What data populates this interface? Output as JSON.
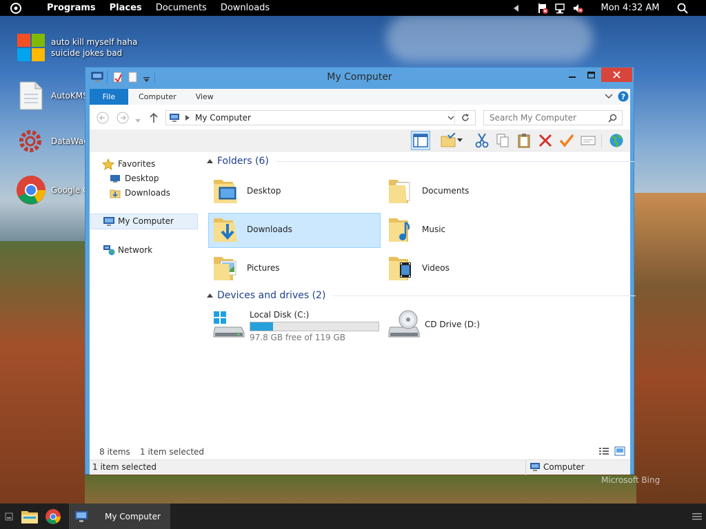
{
  "topbar": {
    "menus": [
      "Programs",
      "Places",
      "Documents",
      "Downloads"
    ],
    "clock": "Mon 4:32 AM"
  },
  "desktop": {
    "icons": [
      {
        "label_line1": "auto kill myself haha",
        "label_line2": "suicide jokes bad",
        "icon": "windows-logo-icon"
      },
      {
        "label": "AutoKMS",
        "icon": "document-icon"
      },
      {
        "label": "DataWag",
        "icon": "gear-icon"
      },
      {
        "label": "Google C",
        "icon": "chrome-icon"
      }
    ],
    "watermark": "Microsoft Bing"
  },
  "window": {
    "title": "My Computer",
    "ribbon_tabs": [
      "File",
      "Computer",
      "View"
    ],
    "address": "My Computer",
    "search_placeholder": "Search My Computer",
    "nav": {
      "favorites": "Favorites",
      "favorite_items": [
        "Desktop",
        "Downloads"
      ],
      "computer": "My Computer",
      "network": "Network"
    },
    "folders_header": "Folders (6)",
    "folders": [
      "Desktop",
      "Documents",
      "Downloads",
      "Music",
      "Pictures",
      "Videos"
    ],
    "devices_header": "Devices and drives (2)",
    "drives": [
      {
        "name": "Local Disk (C:)",
        "free_text": "97.8 GB free of 119 GB",
        "used_fraction": 0.18
      },
      {
        "name": "CD Drive (D:)"
      }
    ],
    "status": {
      "items_count": "8 items",
      "selected": "1 item selected",
      "bottom_selected": "1 item selected",
      "bottom_location": "Computer"
    }
  },
  "taskbar": {
    "active_task": "My Computer"
  },
  "colors": {
    "accent": "#1979ca",
    "selection": "#cce8ff",
    "close": "#d8453d",
    "drive_bar": "#26a0da"
  }
}
